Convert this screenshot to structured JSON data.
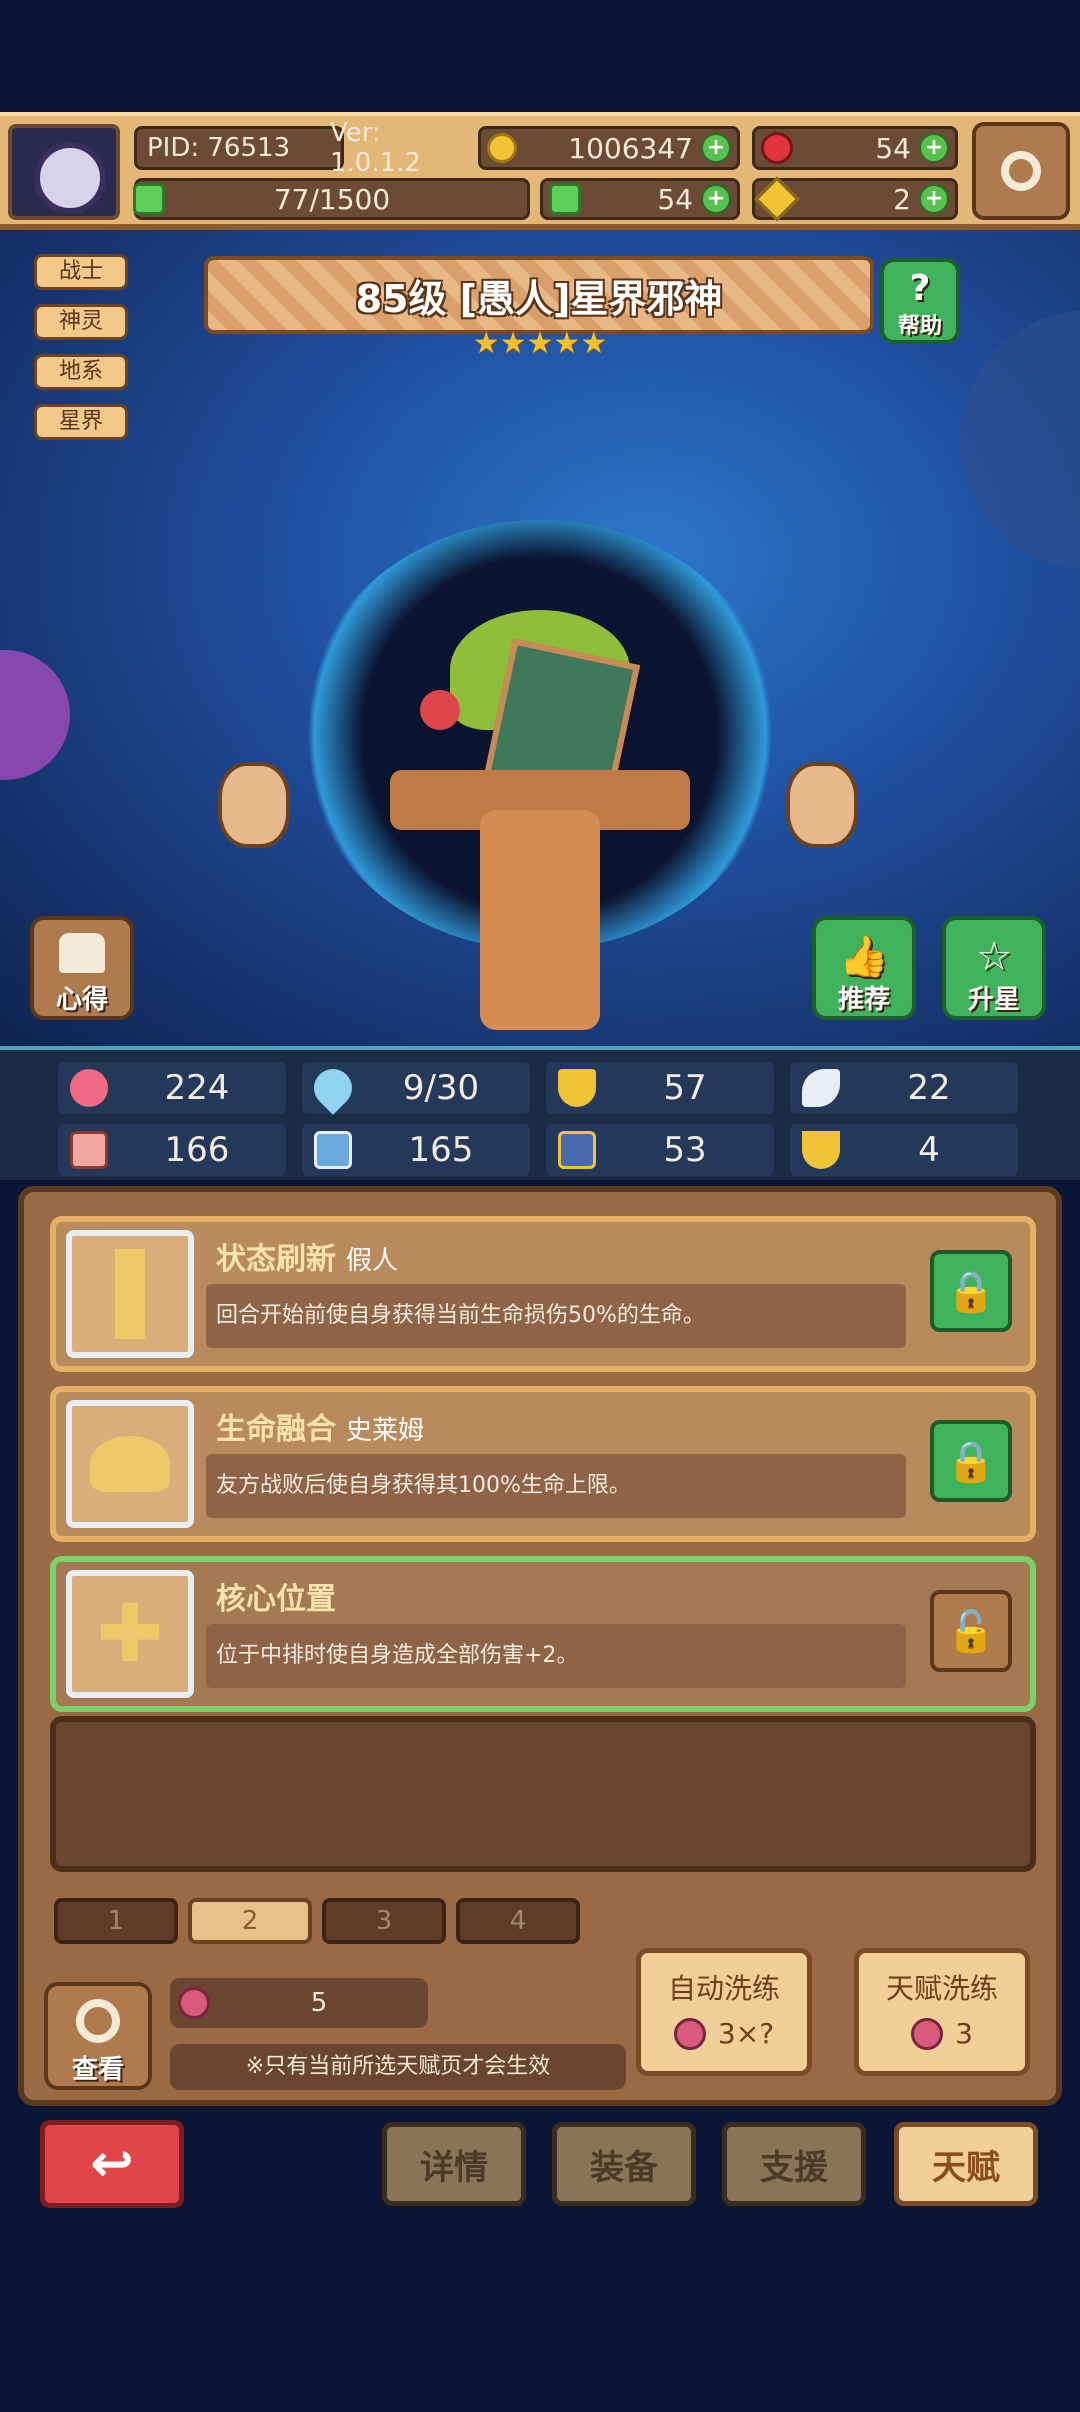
{
  "top_bar": {
    "pid": "PID: 76513",
    "version": "Ver: 1.0.1.2",
    "gold": "1006347",
    "ruby": "54",
    "energy": "77/1500",
    "clover": "54",
    "keys": "2"
  },
  "faction_tags": [
    "战士",
    "神灵",
    "地系",
    "星界"
  ],
  "hero": {
    "title": "85级 [愚人]星界邪神",
    "stars": "★★★★★",
    "help_label": "帮助"
  },
  "side_buttons": {
    "insight": "心得",
    "recommend": "推荐",
    "star_up": "升星"
  },
  "stats": [
    "224",
    "9/30",
    "57",
    "22",
    "166",
    "165",
    "53",
    "4"
  ],
  "talents": [
    {
      "name": "状态刷新",
      "source": "假人",
      "desc": "回合开始前使自身获得当前生命损伤50%的生命。",
      "locked": true
    },
    {
      "name": "生命融合",
      "source": "史莱姆",
      "desc": "友方战败后使自身获得其100%生命上限。",
      "locked": true
    },
    {
      "name": "核心位置",
      "source": "",
      "desc": "位于中排时使自身造成全部伤害+2。",
      "locked": false
    }
  ],
  "pages": [
    "1",
    "2",
    "3",
    "4"
  ],
  "selected_page": "2",
  "view_label": "查看",
  "fruit_count": "5",
  "notice": "※只有当前所选天赋页才会生效",
  "auto_wash": {
    "label": "自动洗练",
    "cost": "3×?"
  },
  "talent_wash": {
    "label": "天赋洗练",
    "cost": "3"
  },
  "bottom_nav": {
    "details": "详情",
    "equip": "装备",
    "support": "支援",
    "talent": "天赋"
  },
  "colors": {
    "accent_green": "#3fb35b",
    "panel_brown": "#9a6a44",
    "back_red": "#e0454b"
  }
}
